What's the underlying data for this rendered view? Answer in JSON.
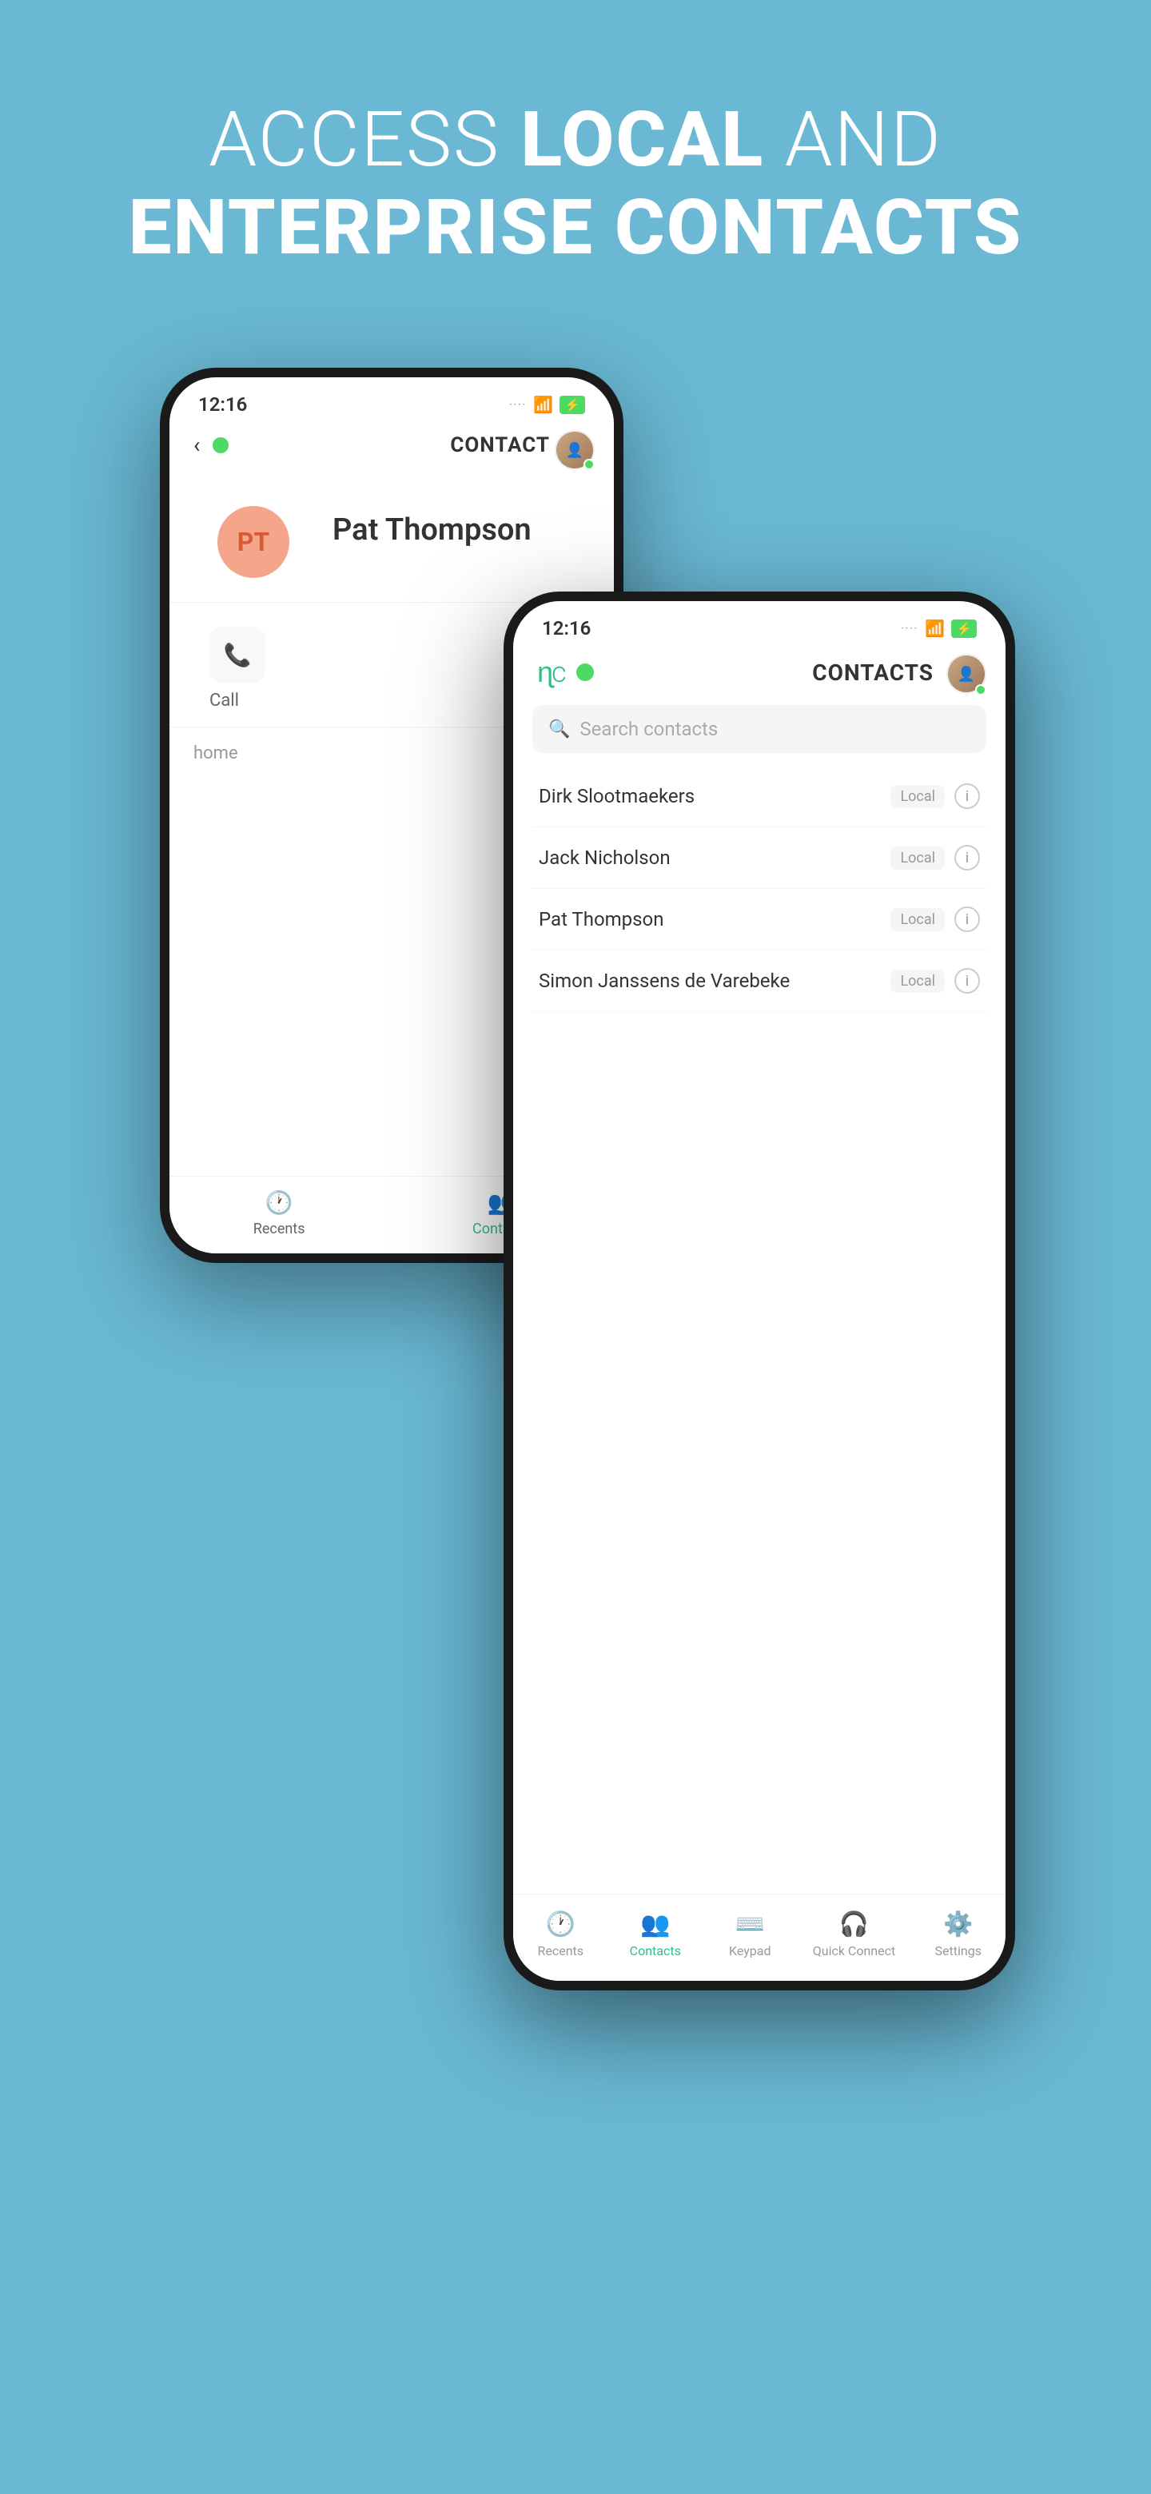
{
  "header": {
    "line1_normal": "ACCESS ",
    "line1_bold": "LOCAL",
    "line1_end": " AND",
    "line2_bold": "ENTERPRISE CONTACTS"
  },
  "back_phone": {
    "status_bar": {
      "time": "12:16",
      "dots": "····",
      "wifi": "wifi",
      "battery": "⚡"
    },
    "header": {
      "title": "CONTACT"
    },
    "contact": {
      "initials": "PT",
      "name": "Pat Thompson"
    },
    "call_label": "Call",
    "home_label": "home",
    "nav": {
      "recents_label": "Recents",
      "contacts_label": "Contacts"
    }
  },
  "front_phone": {
    "status_bar": {
      "time": "12:16",
      "dots": "····",
      "wifi": "wifi",
      "battery": "⚡"
    },
    "header": {
      "title": "CONTACTS"
    },
    "search": {
      "placeholder": "Search contacts"
    },
    "contacts": [
      {
        "name": "Dirk Slootmaekers",
        "badge": "Local"
      },
      {
        "name": "Jack Nicholson",
        "badge": "Local"
      },
      {
        "name": "Pat Thompson",
        "badge": "Local"
      },
      {
        "name": "Simon Janssens de Varebeke",
        "badge": "Local"
      }
    ],
    "nav": {
      "recents": "Recents",
      "contacts": "Contacts",
      "keypad": "Keypad",
      "quick_connect": "Quick Connect",
      "settings": "Settings"
    }
  }
}
